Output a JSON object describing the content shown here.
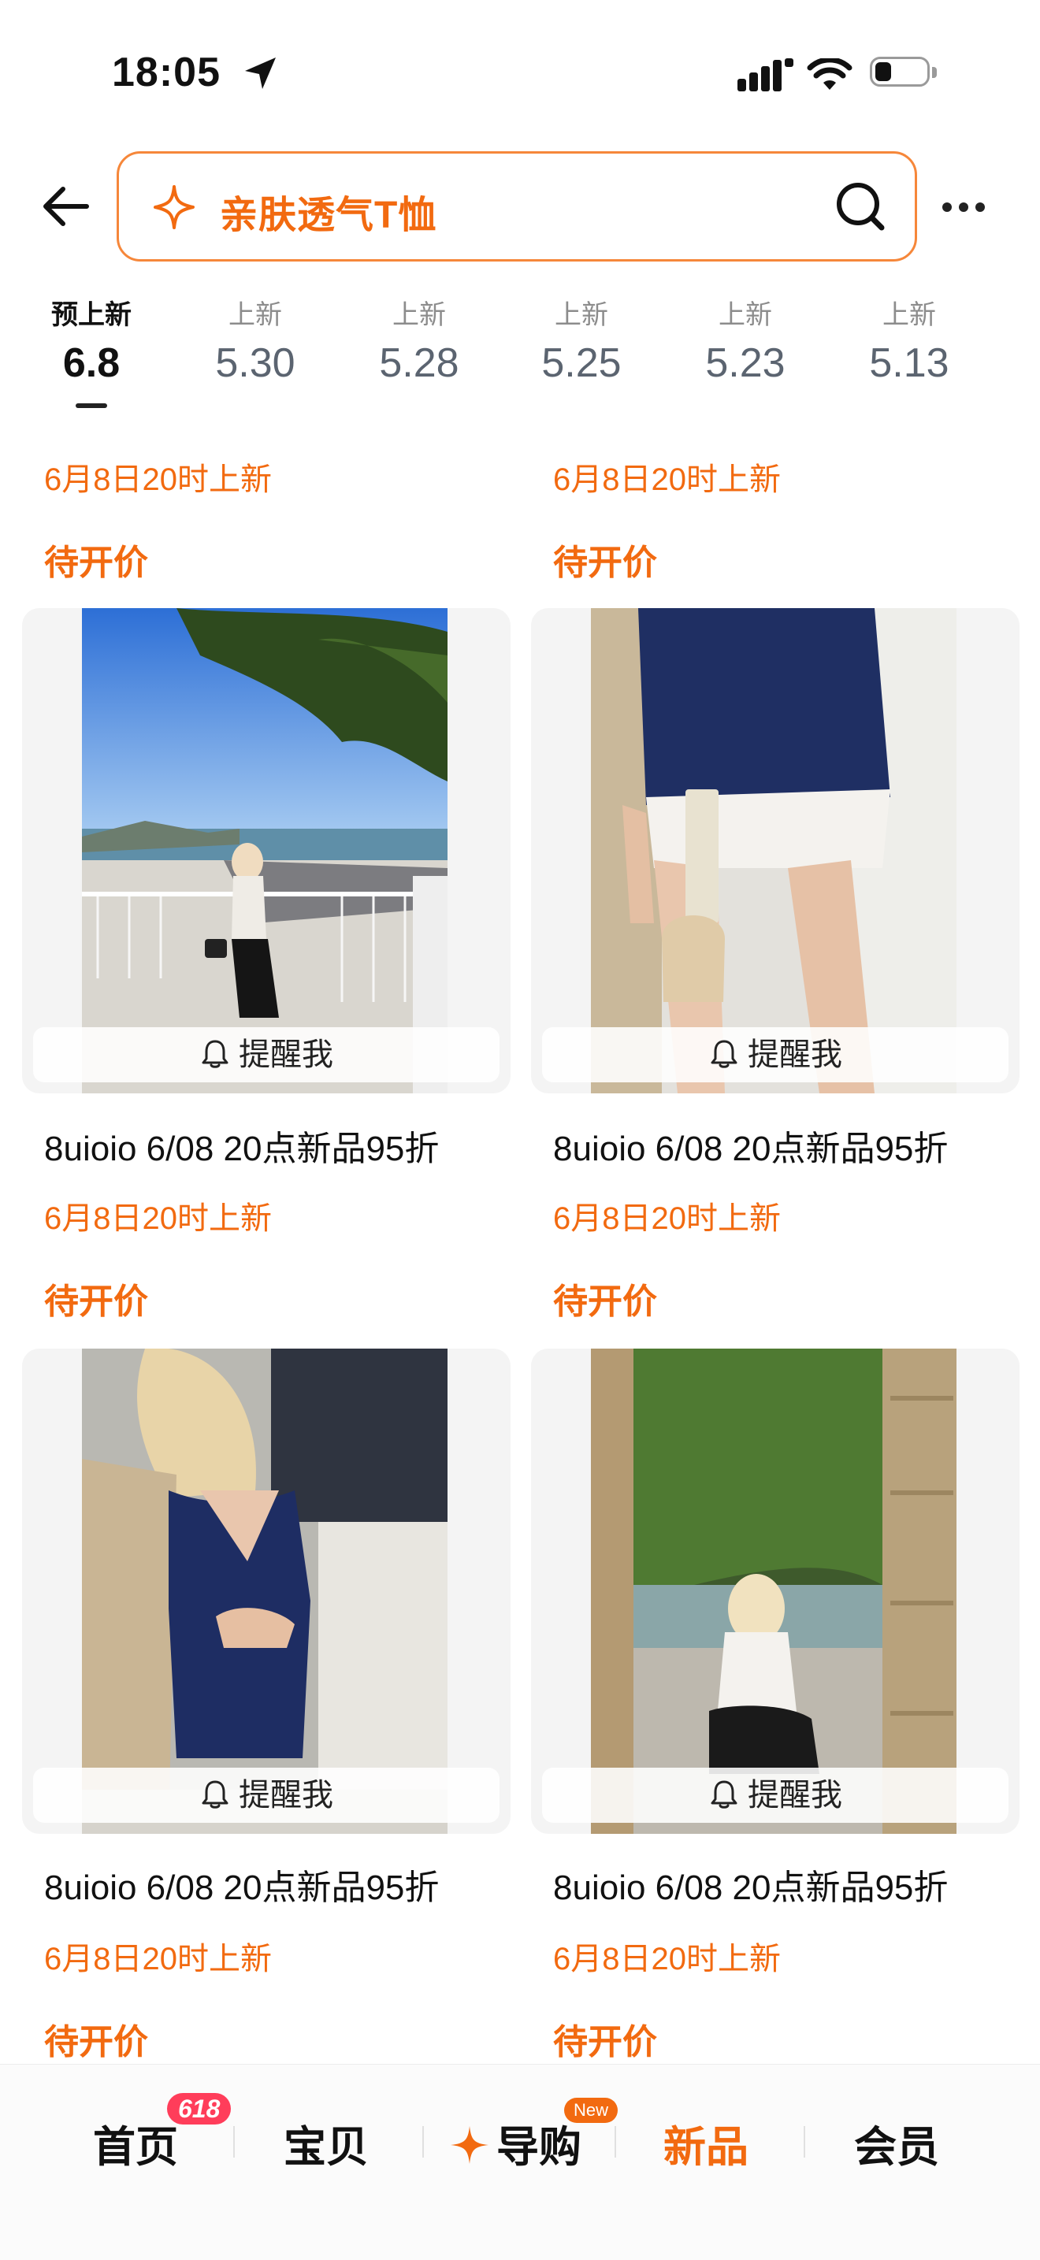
{
  "status_bar": {
    "time": "18:05",
    "icons": [
      "location-arrow-icon",
      "cellular-signal-icon",
      "wifi-icon",
      "battery-icon"
    ]
  },
  "header": {
    "search_query": "亲肤透气T恤",
    "icons": [
      "back-arrow-icon",
      "sparkle-icon",
      "search-icon",
      "more-icon"
    ]
  },
  "tabs": [
    {
      "label": "预上新",
      "date": "6.8",
      "active": true
    },
    {
      "label": "上新",
      "date": "5.30",
      "active": false
    },
    {
      "label": "上新",
      "date": "5.28",
      "active": false
    },
    {
      "label": "上新",
      "date": "5.25",
      "active": false
    },
    {
      "label": "上新",
      "date": "5.23",
      "active": false
    },
    {
      "label": "上新",
      "date": "5.13",
      "active": false
    }
  ],
  "top_partial": [
    {
      "launch": "6月8日20时上新",
      "price": "待开价"
    },
    {
      "launch": "6月8日20时上新",
      "price": "待开价"
    }
  ],
  "products": [
    {
      "remind": "提醒我",
      "title": "8uioio 6/08 20点新品95折",
      "launch": "6月8日20时上新",
      "price": "待开价"
    },
    {
      "remind": "提醒我",
      "title": "8uioio 6/08 20点新品95折",
      "launch": "6月8日20时上新",
      "price": "待开价"
    },
    {
      "remind": "提醒我",
      "title": "8uioio 6/08 20点新品95折",
      "launch": "6月8日20时上新",
      "price": "待开价"
    },
    {
      "remind": "提醒我",
      "title": "8uioio 6/08 20点新品95折",
      "launch": "6月8日20时上新",
      "price": "待开价"
    }
  ],
  "bottom_nav": {
    "home": "首页",
    "home_badge": "618",
    "items": "宝贝",
    "guide": "导购",
    "guide_badge": "New",
    "new": "新品",
    "member": "会员",
    "active": "新品"
  },
  "colors": {
    "accent": "#f26a10",
    "badge_red": "#ff3d5a"
  }
}
